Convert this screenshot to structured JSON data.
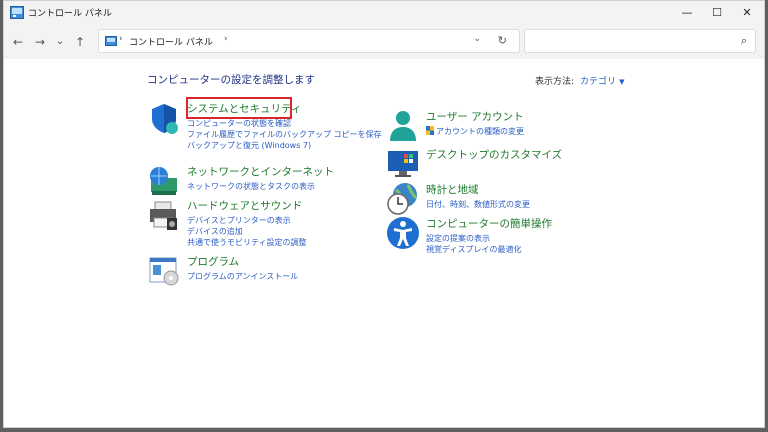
{
  "window": {
    "title": "コントロール パネル",
    "controls": {
      "minimize": "—",
      "maximize": "☐",
      "close": "✕"
    }
  },
  "nav": {
    "back": "←",
    "forward": "→",
    "recent": "⌄",
    "up": "↑",
    "address_crumb": "コントロール パネル",
    "address_sep": "›",
    "address_sep2": "›",
    "dropdown": "⌄",
    "refresh": "↻",
    "search_placeholder": "",
    "search_icon": "⌕"
  },
  "content": {
    "heading": "コンピューターの設定を調整します",
    "view_by_label": "表示方法:",
    "view_by_value": "カテゴリ",
    "view_by_caret": "▼"
  },
  "categories": {
    "security": {
      "icon": "shield-icon",
      "title": "システムとセキュリティ",
      "links": [
        "コンピューターの状態を確認",
        "ファイル履歴でファイルのバックアップ コピーを保存",
        "バックアップと復元 (Windows 7)"
      ]
    },
    "network": {
      "icon": "globe-network-icon",
      "title": "ネットワークとインターネット",
      "links": [
        "ネットワークの状態とタスクの表示"
      ]
    },
    "hardware": {
      "icon": "printer-icon",
      "title": "ハードウェアとサウンド",
      "links": [
        "デバイスとプリンターの表示",
        "デバイスの追加",
        "共通で使うモビリティ設定の調整"
      ]
    },
    "programs": {
      "icon": "programs-icon",
      "title": "プログラム",
      "links": [
        "プログラムのアンインストール"
      ]
    },
    "users": {
      "icon": "user-icon",
      "title": "ユーザー アカウント",
      "links": [
        "アカウントの種類の変更"
      ]
    },
    "appearance": {
      "icon": "monitor-icon",
      "title": "デスクトップのカスタマイズ",
      "links": []
    },
    "clock": {
      "icon": "clock-globe-icon",
      "title": "時計と地域",
      "links": [
        "日付、時刻、数値形式の変更"
      ]
    },
    "ease": {
      "icon": "accessibility-icon",
      "title": "コンピューターの簡単操作",
      "links": [
        "設定の提案の表示",
        "視覚ディスプレイの最適化"
      ]
    }
  },
  "colors": {
    "heading": "#1e3287",
    "category_title": "#1e7a2c",
    "link": "#2a5cc4",
    "highlight": "#d9262b"
  }
}
